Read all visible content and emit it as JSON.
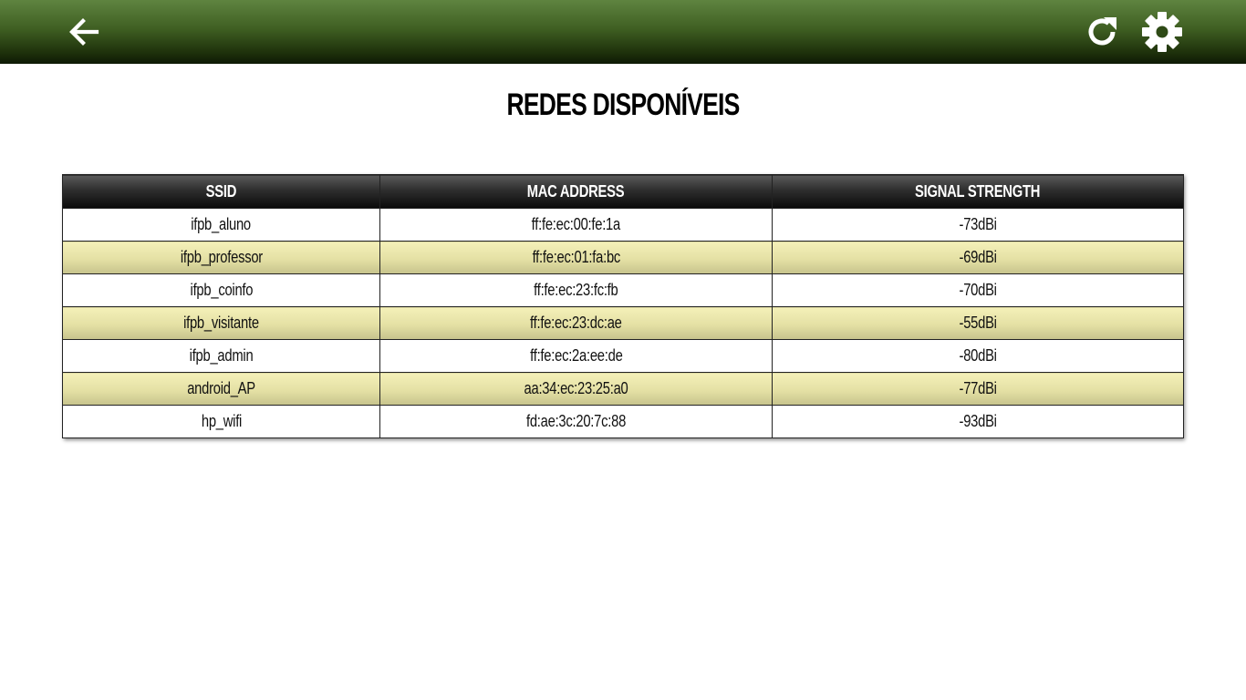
{
  "header": {
    "back_icon": "arrow-left-icon",
    "refresh_icon": "refresh-icon",
    "settings_icon": "gear-icon"
  },
  "page": {
    "title": "REDES DISPONÍVEIS"
  },
  "table": {
    "columns": [
      "SSID",
      "MAC ADDRESS",
      "SIGNAL STRENGTH"
    ],
    "rows": [
      {
        "ssid": "ifpb_aluno",
        "mac": "ff:fe:ec:00:fe:1a",
        "signal": "-73dBi"
      },
      {
        "ssid": "ifpb_professor",
        "mac": "ff:fe:ec:01:fa:bc",
        "signal": "-69dBi"
      },
      {
        "ssid": "ifpb_coinfo",
        "mac": "ff:fe:ec:23:fc:fb",
        "signal": "-70dBi"
      },
      {
        "ssid": "ifpb_visitante",
        "mac": "ff:fe:ec:23:dc:ae",
        "signal": "-55dBi"
      },
      {
        "ssid": "ifpb_admin",
        "mac": "ff:fe:ec:2a:ee:de",
        "signal": "-80dBi"
      },
      {
        "ssid": "android_AP",
        "mac": "aa:34:ec:23:25:a0",
        "signal": "-77dBi"
      },
      {
        "ssid": "hp_wifi",
        "mac": "fd:ae:3c:20:7c:88",
        "signal": "-93dBi"
      }
    ]
  },
  "colors": {
    "header_bar": "#3f5f22",
    "table_header": "#1a1a1a",
    "row_highlight": "#e4e0a4"
  }
}
